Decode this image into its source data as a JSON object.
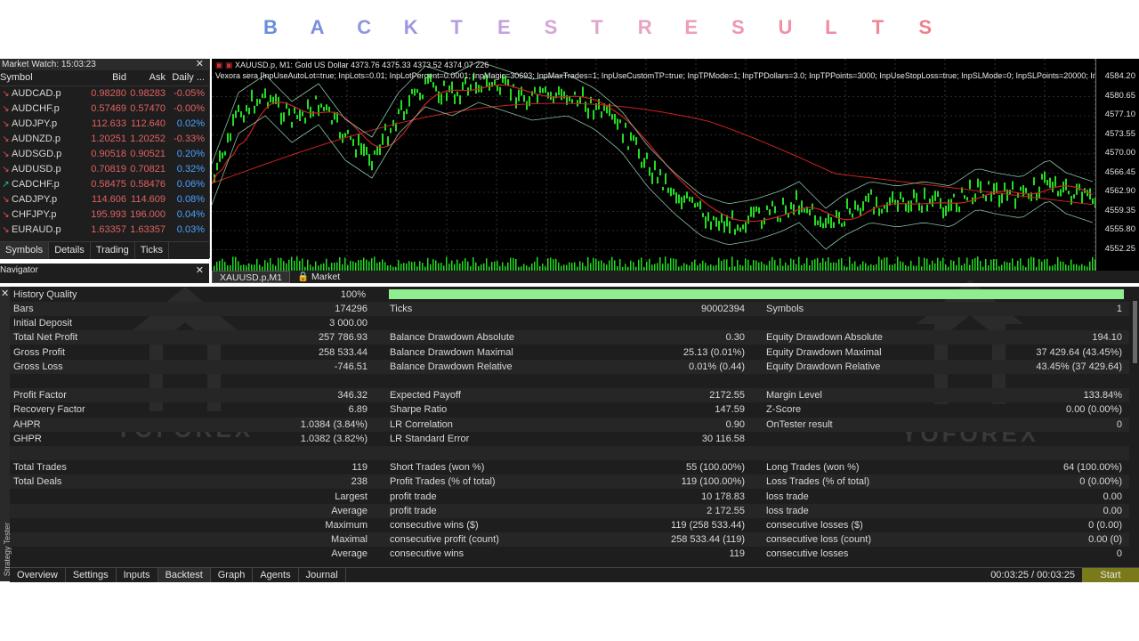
{
  "banner": {
    "letters": [
      {
        "t": "B",
        "c": "#6a8fd8"
      },
      {
        "t": "A",
        "c": "#7a90dc"
      },
      {
        "t": "C",
        "c": "#8f95e0"
      },
      {
        "t": "K",
        "c": "#9c98e0"
      },
      {
        "t": "T",
        "c": "#b39ee0"
      },
      {
        "t": "E",
        "c": "#c5a2dc"
      },
      {
        "t": "S",
        "c": "#d6a4d6"
      },
      {
        "t": "T",
        "c": "#e0a4cf"
      },
      {
        "t": "R",
        "c": "#e8a2c4"
      },
      {
        "t": "E",
        "c": "#ec9ebb"
      },
      {
        "t": "S",
        "c": "#ee98b0"
      },
      {
        "t": "U",
        "c": "#ef92a6"
      },
      {
        "t": "L",
        "c": "#f08c9e"
      },
      {
        "t": "T",
        "c": "#f08696"
      },
      {
        "t": "S",
        "c": "#f0808e"
      }
    ]
  },
  "market_watch": {
    "title": "Market Watch: 15:03:23",
    "headers": {
      "symbol": "Symbol",
      "bid": "Bid",
      "ask": "Ask",
      "daily": "Daily ..."
    },
    "rows": [
      {
        "sym": "AUDCAD.p",
        "bid": "0.98280",
        "ask": "0.98283",
        "daily": "-0.05%",
        "dir": "down"
      },
      {
        "sym": "AUDCHF.p",
        "bid": "0.57469",
        "ask": "0.57470",
        "daily": "-0.00%",
        "dir": "down"
      },
      {
        "sym": "AUDJPY.p",
        "bid": "112.633",
        "ask": "112.640",
        "daily": "0.02%",
        "dir": "down"
      },
      {
        "sym": "AUDNZD.p",
        "bid": "1.20251",
        "ask": "1.20252",
        "daily": "-0.33%",
        "dir": "down"
      },
      {
        "sym": "AUDSGD.p",
        "bid": "0.90518",
        "ask": "0.90521",
        "daily": "0.20%",
        "dir": "down"
      },
      {
        "sym": "AUDUSD.p",
        "bid": "0.70819",
        "ask": "0.70821",
        "daily": "0.32%",
        "dir": "down"
      },
      {
        "sym": "CADCHF.p",
        "bid": "0.58475",
        "ask": "0.58476",
        "daily": "0.06%",
        "dir": "up"
      },
      {
        "sym": "CADJPY.p",
        "bid": "114.606",
        "ask": "114.609",
        "daily": "0.08%",
        "dir": "down"
      },
      {
        "sym": "CHFJPY.p",
        "bid": "195.993",
        "ask": "196.000",
        "daily": "0.04%",
        "dir": "down"
      },
      {
        "sym": "EURAUD.p",
        "bid": "1.63357",
        "ask": "1.63357",
        "daily": "0.03%",
        "dir": "down"
      }
    ],
    "tabs": [
      "Symbols",
      "Details",
      "Trading",
      "Ticks"
    ]
  },
  "navigator": {
    "title": "Navigator"
  },
  "chart": {
    "symbol_line": "XAUUSD.p, M1:  Gold US Dollar  4373.76 4375.33 4373.52 4374.07  226",
    "ea_line": "Vexora sera [InpUseAutoLot=true; InpLots=0.01; InpLotPercent=0.0001; InpMagic=30693; InpMaxTrades=1; InpUseCustomTP=true; InpTPMode=1; InpTPDollars=3.0; InpTPPoints=3000; InpUseStopLoss=true; InpSLMode=0; InpSLPoints=20000; InpSLDollars=50.",
    "price_labels": [
      "4584.20",
      "4580.65",
      "4577.10",
      "4573.55",
      "4570.00",
      "4566.45",
      "4562.90",
      "4559.35",
      "4555.80",
      "4552.25"
    ],
    "tabs": [
      "XAUUSD.p,M1",
      "Market"
    ]
  },
  "tester": {
    "history_quality_label": "History Quality",
    "history_quality_value": "100%",
    "rows": [
      {
        "c": [
          "Bars",
          "174296",
          "Ticks",
          "90002394",
          "Symbols",
          "1"
        ]
      },
      {
        "c": [
          "Initial Deposit",
          "3 000.00",
          "",
          "",
          "",
          ""
        ]
      },
      {
        "c": [
          "Total Net Profit",
          "257 786.93",
          "Balance Drawdown Absolute",
          "0.30",
          "Equity Drawdown Absolute",
          "194.10"
        ]
      },
      {
        "c": [
          "Gross Profit",
          "258 533.44",
          "Balance Drawdown Maximal",
          "25.13 (0.01%)",
          "Equity Drawdown Maximal",
          "37 429.64 (43.45%)"
        ]
      },
      {
        "c": [
          "Gross Loss",
          "-746.51",
          "Balance Drawdown Relative",
          "0.01% (0.44)",
          "Equity Drawdown Relative",
          "43.45% (37 429.64)"
        ]
      },
      {
        "c": [
          "",
          "",
          "",
          "",
          "",
          ""
        ]
      },
      {
        "c": [
          "Profit Factor",
          "346.32",
          "Expected Payoff",
          "2172.55",
          "Margin Level",
          "133.84%"
        ]
      },
      {
        "c": [
          "Recovery Factor",
          "6.89",
          "Sharpe Ratio",
          "147.59",
          "Z-Score",
          "0.00 (0.00%)"
        ]
      },
      {
        "c": [
          "AHPR",
          "1.0384 (3.84%)",
          "LR Correlation",
          "0.90",
          "OnTester result",
          "0"
        ]
      },
      {
        "c": [
          "GHPR",
          "1.0382 (3.82%)",
          "LR Standard Error",
          "30 116.58",
          "",
          ""
        ]
      },
      {
        "c": [
          "",
          "",
          "",
          "",
          "",
          ""
        ]
      },
      {
        "c": [
          "Total Trades",
          "119",
          "Short Trades (won %)",
          "55 (100.00%)",
          "Long Trades (won %)",
          "64 (100.00%)"
        ]
      },
      {
        "c": [
          "Total Deals",
          "238",
          "Profit Trades (% of total)",
          "119 (100.00%)",
          "Loss Trades (% of total)",
          "0 (0.00%)"
        ]
      },
      {
        "c": [
          "",
          "Largest",
          "profit trade",
          "10 178.83",
          "loss trade",
          "0.00"
        ]
      },
      {
        "c": [
          "",
          "Average",
          "profit trade",
          "2 172.55",
          "loss trade",
          "0.00"
        ]
      },
      {
        "c": [
          "",
          "Maximum",
          "consecutive wins ($)",
          "119 (258 533.44)",
          "consecutive losses ($)",
          "0 (0.00)"
        ]
      },
      {
        "c": [
          "",
          "Maximal",
          "consecutive profit (count)",
          "258 533.44 (119)",
          "consecutive loss (count)",
          "0.00 (0)"
        ]
      },
      {
        "c": [
          "",
          "Average",
          "consecutive wins",
          "119",
          "consecutive losses",
          "0"
        ]
      }
    ],
    "tabs": [
      "Overview",
      "Settings",
      "Inputs",
      "Backtest",
      "Graph",
      "Agents",
      "Journal"
    ],
    "active_tab": "Backtest",
    "time": "00:03:25 / 00:03:25",
    "start_label": "Start",
    "side_label": "Strategy Tester"
  },
  "watermark": {
    "text": "YOFOREX"
  },
  "colors": {
    "up_arrow": "#2ecc71",
    "down_arrow": "#e05050",
    "bid_ask": "#e06060",
    "pos": "#4aa0ff",
    "neg": "#e06060",
    "candle": "#22dd22",
    "ma_red": "#cc2222",
    "band": "#88c0a0"
  }
}
